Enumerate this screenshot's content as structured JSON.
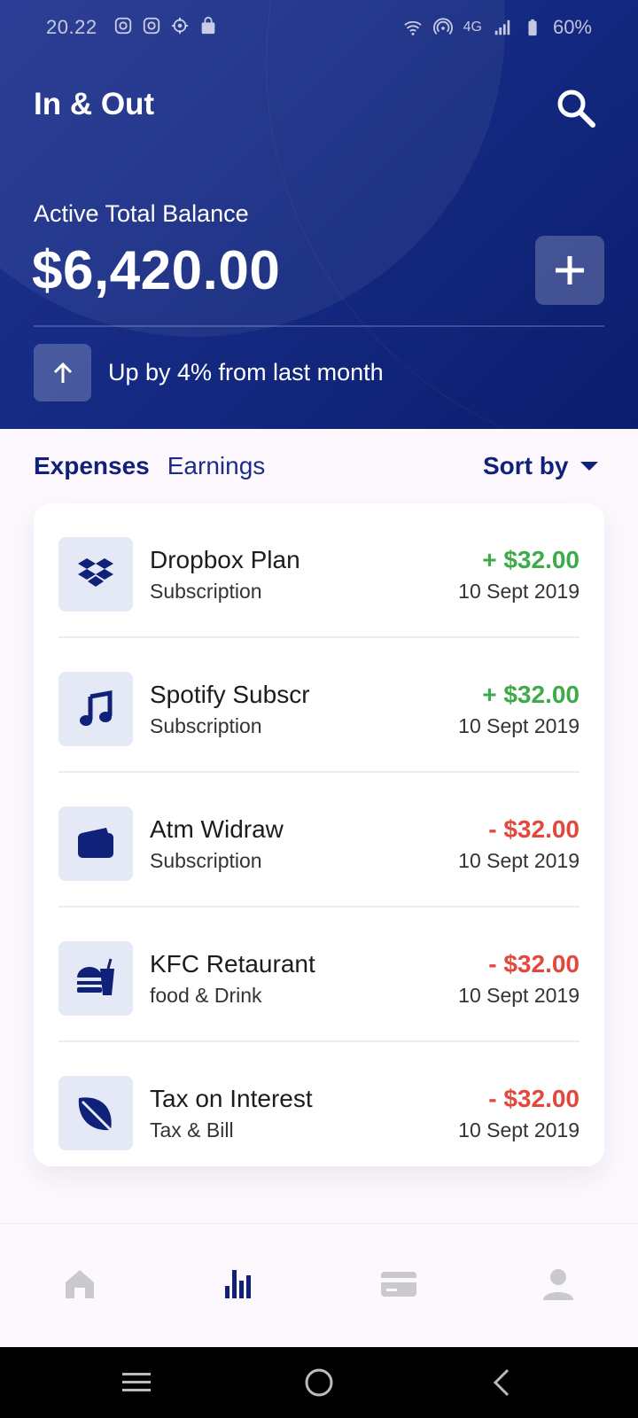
{
  "status_bar": {
    "time": "20.22",
    "network": "4G",
    "battery": "60%",
    "left_icons": [
      "instagram-icon",
      "instagram-icon",
      "settings-gear-icon",
      "shop-bag-icon"
    ],
    "right_icons": [
      "wifi-icon",
      "hotspot-icon",
      "signal-icon",
      "battery-icon"
    ]
  },
  "header": {
    "title": "In & Out",
    "search_icon": "search-icon",
    "balance_label": "Active Total Balance",
    "balance_value": "$6,420.00",
    "add_icon": "plus-icon",
    "trend_icon": "arrow-up-icon",
    "trend_text": "Up by 4% from last month"
  },
  "tabs": {
    "expenses": "Expenses",
    "earnings": "Earnings",
    "active": "Expenses",
    "sort_label": "Sort by"
  },
  "transactions": [
    {
      "name": "Dropbox Plan",
      "category": "Subscription",
      "amount": "+ $32.00",
      "date": "10 Sept 2019",
      "type": "positive",
      "icon": "dropbox-icon"
    },
    {
      "name": "Spotify Subscr",
      "category": "Subscription",
      "amount": "+ $32.00",
      "date": "10 Sept 2019",
      "type": "positive",
      "icon": "music-note-icon"
    },
    {
      "name": "Atm Widraw",
      "category": "Subscription",
      "amount": "- $32.00",
      "date": "10 Sept 2019",
      "type": "negative",
      "icon": "wallet-icon"
    },
    {
      "name": "KFC Retaurant",
      "category": "food & Drink",
      "amount": "- $32.00",
      "date": "10 Sept 2019",
      "type": "negative",
      "icon": "fast-food-icon"
    },
    {
      "name": "Tax on Interest",
      "category": "Tax & Bill",
      "amount": "- $32.00",
      "date": "10 Sept 2019",
      "type": "negative",
      "icon": "leaf-icon"
    }
  ],
  "bottom_nav": [
    {
      "icon": "home-icon",
      "active": false
    },
    {
      "icon": "bar-chart-icon",
      "active": true
    },
    {
      "icon": "credit-card-icon",
      "active": false
    },
    {
      "icon": "profile-icon",
      "active": false
    }
  ],
  "colors": {
    "primary": "#13287f",
    "positive": "#3eab4a",
    "negative": "#e4473c",
    "icon_bg": "#e5e9f5",
    "nav_inactive": "#c9c9cf"
  }
}
